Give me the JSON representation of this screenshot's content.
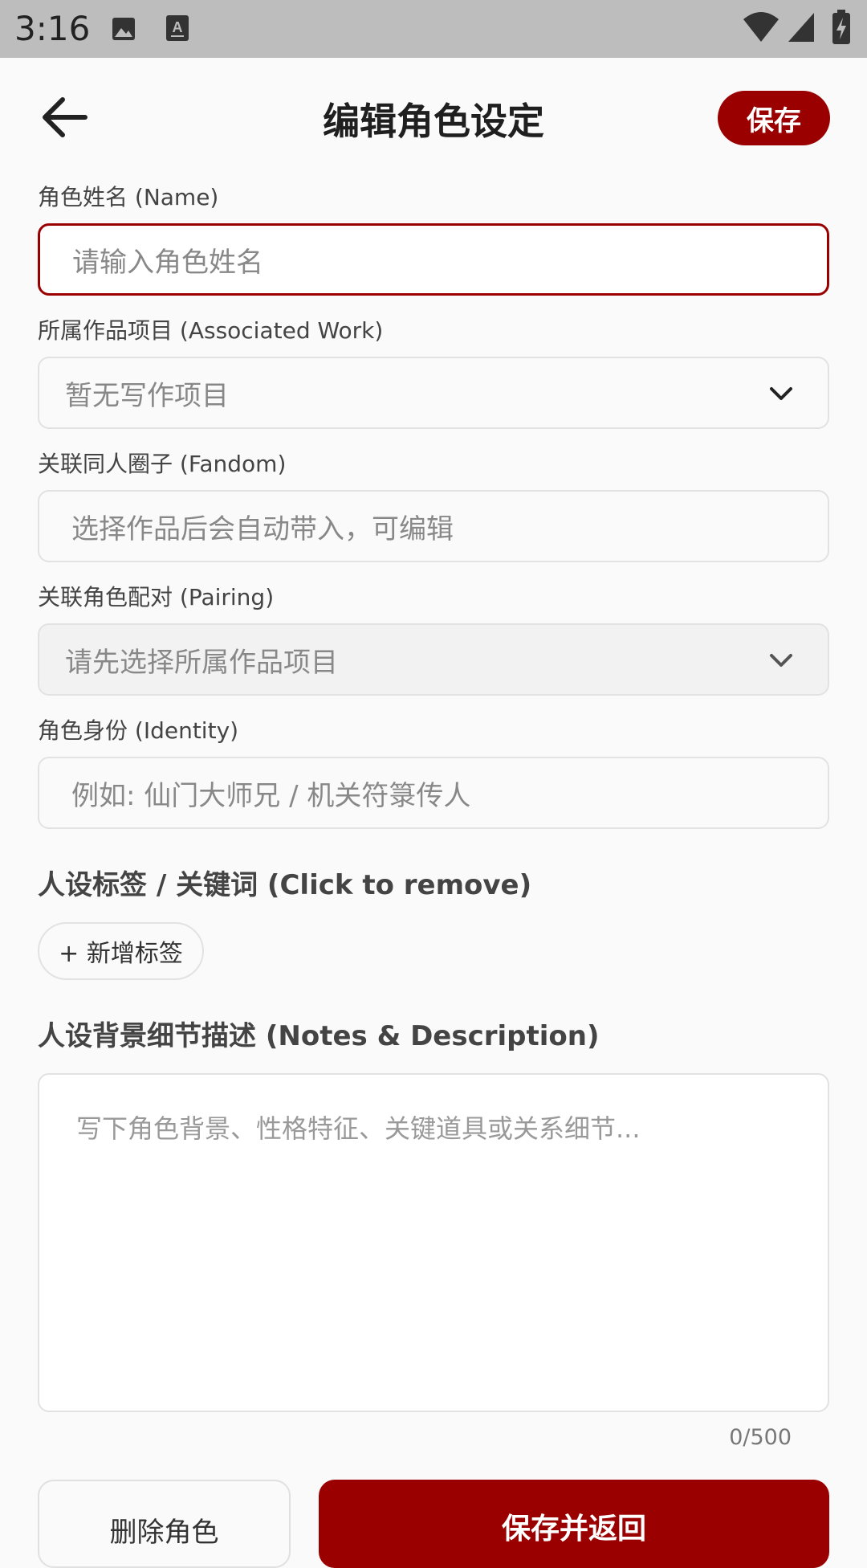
{
  "status_bar": {
    "time": "3:16",
    "icons": [
      "image-icon",
      "text-icon",
      "wifi-icon",
      "signal-icon",
      "battery-icon"
    ]
  },
  "app_bar": {
    "title": "编辑角色设定",
    "save_label": "保存"
  },
  "form": {
    "name": {
      "label": "角色姓名 (Name)",
      "placeholder": "请输入角色姓名"
    },
    "work": {
      "label": "所属作品项目 (Associated Work)",
      "value": "暂无写作项目"
    },
    "fandom": {
      "label": "关联同人圈子 (Fandom)",
      "placeholder": "选择作品后会自动带入，可编辑"
    },
    "pairing": {
      "label": "关联角色配对 (Pairing)",
      "value": "请先选择所属作品项目"
    },
    "identity": {
      "label": "角色身份 (Identity)",
      "placeholder": "例如: 仙门大师兄 / 机关符箓传人"
    }
  },
  "tags": {
    "title": "人设标签 / 关键词 (Click to remove)",
    "add_label": "+ 新增标签"
  },
  "notes": {
    "title": "人设背景细节描述 (Notes & Description)",
    "placeholder": "写下角色背景、性格特征、关键道具或关系细节...",
    "counter": "0/500"
  },
  "actions": {
    "delete_label": "删除角色",
    "save_return_label": "保存并返回"
  },
  "colors": {
    "accent": "#9a0000",
    "status_bar": "#bdbdbd",
    "background": "#fafafa"
  }
}
